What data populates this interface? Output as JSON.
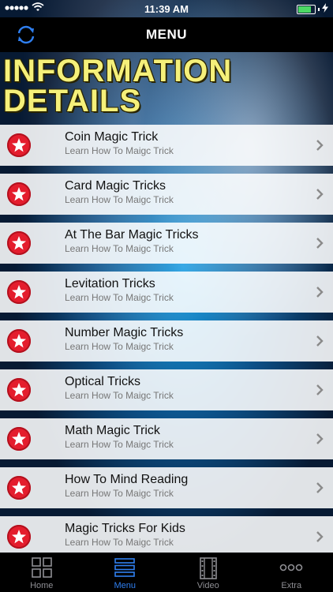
{
  "status_bar": {
    "time": "11:39 AM",
    "battery_level": 0.9
  },
  "nav": {
    "title": "MENU"
  },
  "banner": {
    "line1": "INFORMATION",
    "line2": "DETAILS"
  },
  "list": {
    "items": [
      {
        "title": "Coin Magic Trick",
        "subtitle": "Learn How To Maigc Trick"
      },
      {
        "title": "Card Magic Tricks",
        "subtitle": "Learn How To Maigc Trick"
      },
      {
        "title": "At The Bar Magic Tricks",
        "subtitle": "Learn How To Maigc Trick"
      },
      {
        "title": "Levitation Tricks",
        "subtitle": "Learn How To Maigc Trick"
      },
      {
        "title": "Number Magic Tricks",
        "subtitle": "Learn How To Maigc Trick"
      },
      {
        "title": "Optical Tricks",
        "subtitle": "Learn How To Maigc Trick"
      },
      {
        "title": "Math Magic Trick",
        "subtitle": "Learn How To Maigc Trick"
      },
      {
        "title": "How To Mind Reading",
        "subtitle": "Learn How To Maigc Trick"
      },
      {
        "title": "Magic Tricks For Kids",
        "subtitle": "Learn How To Maigc Trick"
      }
    ]
  },
  "tabs": [
    {
      "label": "Home",
      "icon": "grid-icon",
      "active": false
    },
    {
      "label": "Menu",
      "icon": "list-icon",
      "active": true
    },
    {
      "label": "Video",
      "icon": "film-icon",
      "active": false
    },
    {
      "label": "Extra",
      "icon": "more-icon",
      "active": false
    }
  ],
  "colors": {
    "accent": "#2f7ff0",
    "badge": "#e41d2d",
    "banner_text": "#f5f07a",
    "battery": "#4cd964"
  }
}
